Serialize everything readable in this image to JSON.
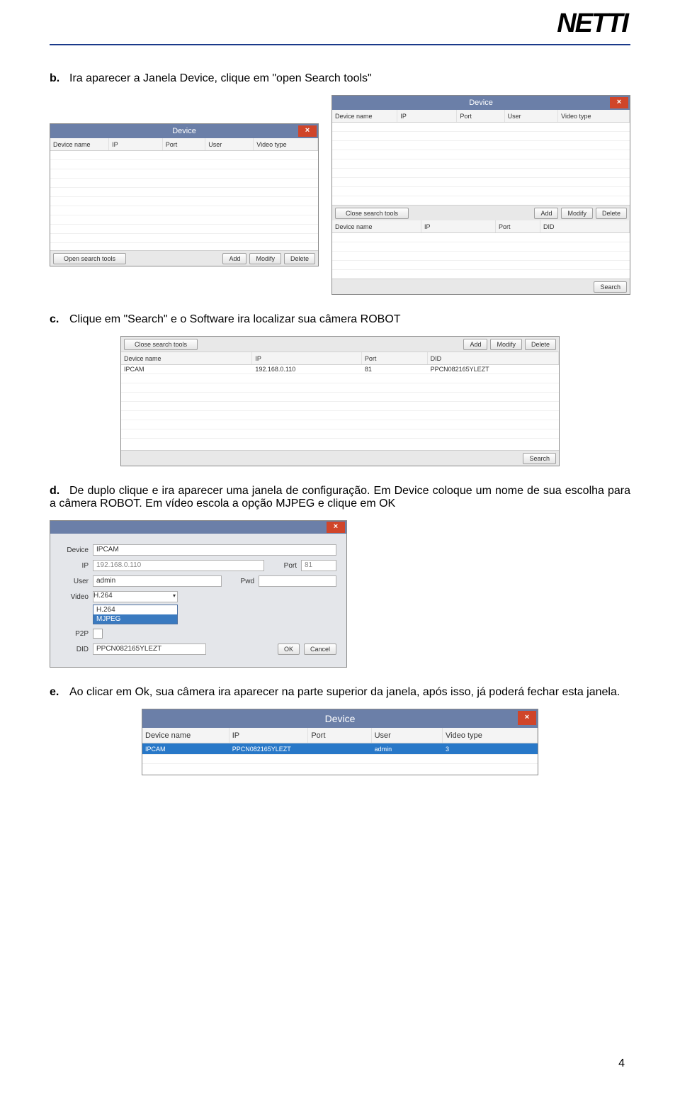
{
  "logo_text": "NETTI",
  "page_number": "4",
  "instr_b": {
    "label": "b.",
    "text": "Ira aparecer a Janela Device, clique em \"open Search tools\""
  },
  "instr_c": {
    "label": "c.",
    "text": "Clique em \"Search\" e o Software ira localizar sua câmera ROBOT"
  },
  "instr_d": {
    "label": "d.",
    "text": "De duplo clique e ira aparecer uma janela de configuração. Em Device coloque um nome de sua escolha para a câmera ROBOT. Em vídeo escola a opção MJPEG e clique em OK"
  },
  "instr_e": {
    "label": "e.",
    "text": "Ao clicar em Ok, sua câmera ira aparecer na parte superior da janela, após isso, já poderá fechar esta janela."
  },
  "win_title": "Device",
  "close_x": "×",
  "cols5": {
    "c1": "Device name",
    "c2": "IP",
    "c3": "Port",
    "c4": "User",
    "c5": "Video type"
  },
  "cols4": {
    "c1": "Device name",
    "c2": "IP",
    "c3": "Port",
    "c4": "DID"
  },
  "btns": {
    "open_search": "Open search tools",
    "close_search": "Close search tools",
    "add": "Add",
    "modify": "Modify",
    "delete": "Delete",
    "search": "Search",
    "ok": "OK",
    "cancel": "Cancel"
  },
  "search_row": {
    "name": "IPCAM",
    "ip": "192.168.0.110",
    "port": "81",
    "did": "PPCN082165YLEZT"
  },
  "form": {
    "labels": {
      "device": "Device",
      "ip": "IP",
      "port": "Port",
      "user": "User",
      "pwd": "Pwd",
      "video": "Video",
      "p2p": "P2P",
      "did": "DID"
    },
    "values": {
      "device": "IPCAM",
      "ip": "192.168.0.110",
      "port": "81",
      "user": "admin",
      "pwd": "",
      "video_selected": "H.264",
      "did": "PPCN082165YLEZT"
    },
    "dropdown": {
      "opt1": "H.264",
      "opt2": "MJPEG"
    }
  },
  "final_row": {
    "name": "IPCAM",
    "ip": "PPCN082165YLEZT",
    "port": "",
    "user": "admin",
    "video": "3"
  }
}
